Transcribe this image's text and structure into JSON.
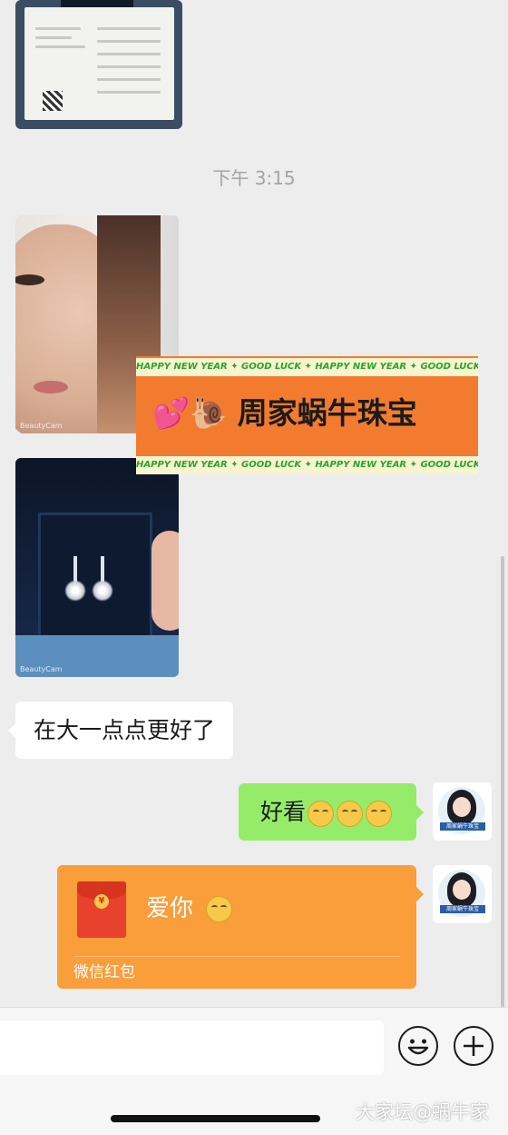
{
  "chat": {
    "timestamp": "下午 3:15",
    "received_text": "在大一点点更好了",
    "sent_text": "好看",
    "sent_emoji_count": 3,
    "red_packet": {
      "message": "爱你",
      "label": "微信红包"
    }
  },
  "banner": {
    "ticker": "HAPPY NEW YEAR ✦ GOOD LUCK ✦ HAPPY NEW YEAR ✦ GOOD LUCK ✦",
    "title": "周家蜗牛珠宝",
    "title_prefix_icons": "💕🐌"
  },
  "photos": {
    "watermark": "BeautyCam"
  },
  "avatar": {
    "caption": "周家蜗牛珠宝"
  },
  "input": {
    "emoji_button": "☺",
    "plus_button": "+"
  },
  "site_watermark": "大家坛@蜗牛家",
  "colors": {
    "background": "#ededed",
    "sent_bubble": "#95ec69",
    "received_bubble": "#ffffff",
    "red_packet": "#fa9d3b",
    "banner": "#f27b30"
  }
}
